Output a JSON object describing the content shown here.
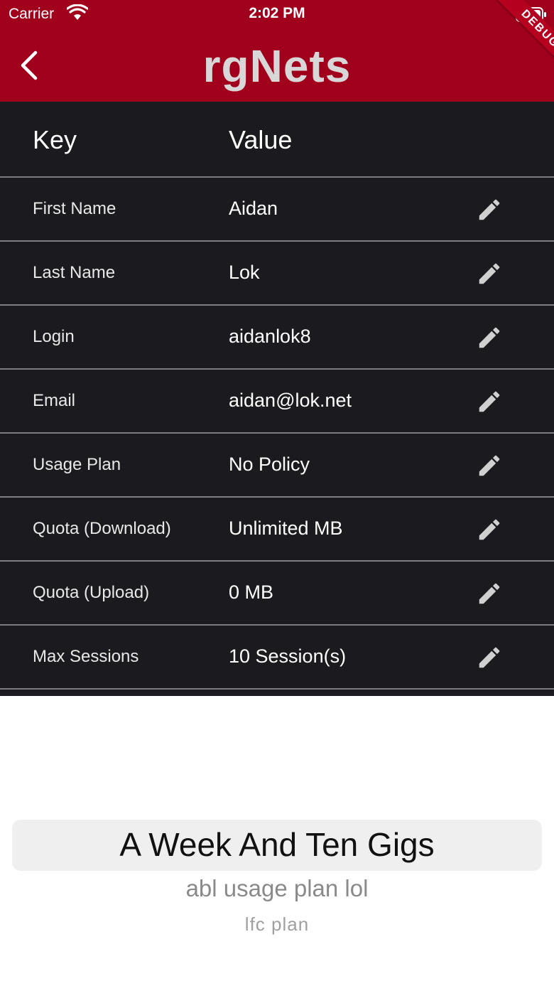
{
  "status_bar": {
    "carrier": "Carrier",
    "time": "2:02 PM"
  },
  "app_bar": {
    "logo": "rgNets",
    "debug_banner": "DEBUG"
  },
  "table": {
    "key_header": "Key",
    "value_header": "Value",
    "rows": [
      {
        "key": "First Name",
        "value": "Aidan"
      },
      {
        "key": "Last Name",
        "value": "Lok"
      },
      {
        "key": "Login",
        "value": "aidanlok8"
      },
      {
        "key": "Email",
        "value": "aidan@lok.net"
      },
      {
        "key": "Usage Plan",
        "value": "No Policy"
      },
      {
        "key": "Quota (Download)",
        "value": "Unlimited MB"
      },
      {
        "key": "Quota (Upload)",
        "value": "0 MB"
      },
      {
        "key": "Max Sessions",
        "value": "10 Session(s)"
      }
    ]
  },
  "picker": {
    "options": [
      "A Week And Ten Gigs",
      "abl usage plan lol",
      "lfc plan"
    ],
    "selected": "A Week And Ten Gigs"
  },
  "colors": {
    "app_bar": "#a0001c",
    "table_bg": "#1b1b1f",
    "divider": "#7c7c80"
  }
}
